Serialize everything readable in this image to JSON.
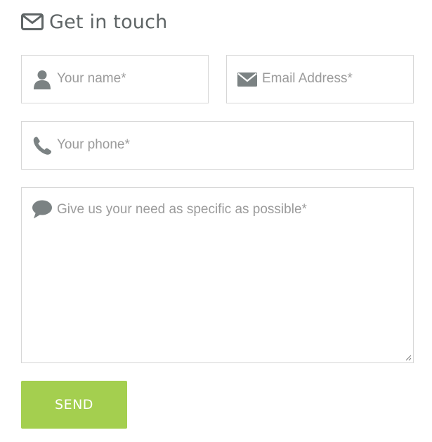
{
  "header": {
    "title": "Get in touch",
    "icon": "envelope-outline-icon"
  },
  "form": {
    "name": {
      "placeholder": "Your name*",
      "value": "",
      "icon": "user-icon"
    },
    "email": {
      "placeholder": "Email Address*",
      "value": "",
      "icon": "envelope-icon"
    },
    "phone": {
      "placeholder": "Your phone*",
      "value": "",
      "icon": "phone-icon"
    },
    "message": {
      "placeholder": "Give us your need as specific as possible*",
      "value": "",
      "icon": "speech-bubble-icon"
    },
    "submit_label": "SEND"
  },
  "colors": {
    "accent": "#a4cf4f",
    "heading_text": "#5f6566",
    "placeholder_text": "#9b9b9b",
    "icon": "#7b8283",
    "border": "#d7d7d7"
  }
}
